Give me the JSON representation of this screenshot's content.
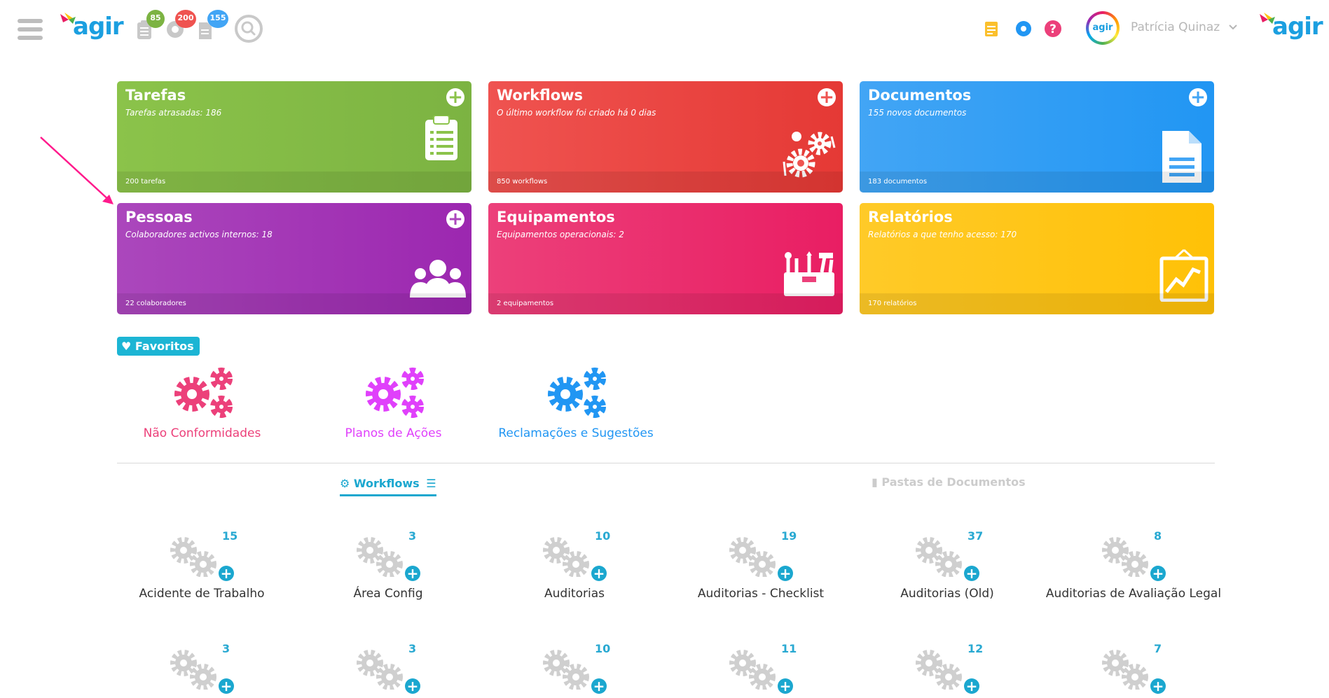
{
  "header": {
    "logo_text": "agir",
    "badges": {
      "tasks": "85",
      "workflows": "200",
      "documents": "155"
    },
    "user_name": "Patrícia Quinaz",
    "avatar_logo": "agir",
    "right_logo_text": "agir",
    "icons": [
      "menu-icon",
      "clipboard-icon",
      "gear-badge-icon",
      "document-icon",
      "search-icon",
      "notepad-icon",
      "settings-icon",
      "help-icon",
      "chevron-down-icon"
    ]
  },
  "tiles": [
    {
      "title": "Tarefas",
      "subtitle": "Tarefas atrasadas: 186",
      "footer": "200 tarefas",
      "color": "#8bc34a",
      "icon": "clipboard-list-icon",
      "has_add": true
    },
    {
      "title": "Workflows",
      "subtitle": "O último workflow foi criado há 0 dias",
      "footer": "850 workflows",
      "color": "#ef5350",
      "icon": "gears-icon",
      "has_add": true
    },
    {
      "title": "Documentos",
      "subtitle": "155 novos documentos",
      "footer": "183 documentos",
      "color": "#42a5f5",
      "icon": "document-lines-icon",
      "has_add": true
    },
    {
      "title": "Pessoas",
      "subtitle": "Colaboradores activos internos: 18",
      "footer": "22 colaboradores",
      "color": "#ab47bc",
      "icon": "people-icon",
      "has_add": true
    },
    {
      "title": "Equipamentos",
      "subtitle": "Equipamentos operacionais: 2",
      "footer": "2 equipamentos",
      "color": "#ec407a",
      "icon": "toolbox-icon",
      "has_add": false
    },
    {
      "title": "Relatórios",
      "subtitle": "Relatórios a que tenho acesso: 170",
      "footer": "170 relatórios",
      "color": "#ffca28",
      "icon": "chart-board-icon",
      "has_add": false
    }
  ],
  "favorites": {
    "label": "Favoritos",
    "items": [
      {
        "label": "Não Conformidades",
        "color": "#ec407a"
      },
      {
        "label": "Planos de Ações",
        "color": "#e040fb"
      },
      {
        "label": "Reclamações e Sugestões",
        "color": "#2196f3"
      }
    ]
  },
  "tabs": {
    "workflows": "Workflows",
    "folders": "Pastas de Documentos"
  },
  "workflows": [
    {
      "name": "Acidente de Trabalho",
      "count": "15"
    },
    {
      "name": "Área Config",
      "count": "3"
    },
    {
      "name": "Auditorias",
      "count": "10"
    },
    {
      "name": "Auditorias - Checklist",
      "count": "19"
    },
    {
      "name": "Auditorias (Old)",
      "count": "37"
    },
    {
      "name": "Auditorias de Avaliação Legal",
      "count": "8"
    },
    {
      "name": "",
      "count": "3"
    },
    {
      "name": "",
      "count": "3"
    },
    {
      "name": "",
      "count": "10"
    },
    {
      "name": "",
      "count": "11"
    },
    {
      "name": "",
      "count": "12"
    },
    {
      "name": "",
      "count": "7"
    }
  ],
  "colors": {
    "accent": "#1ba7cf",
    "arrow": "#ff1a8c"
  }
}
